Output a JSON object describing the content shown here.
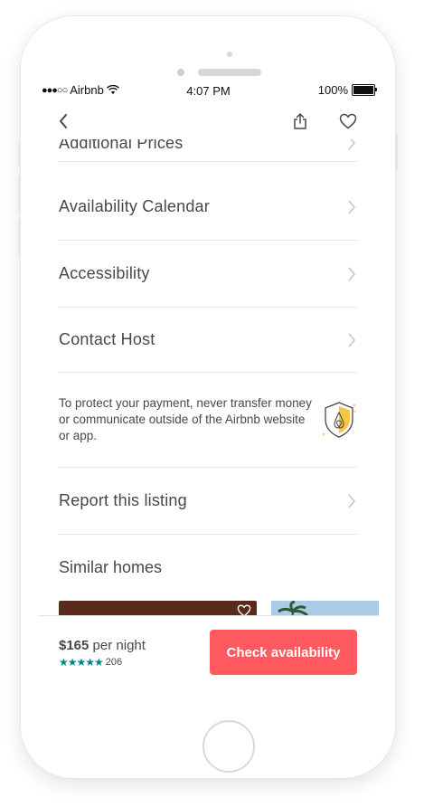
{
  "status_bar": {
    "carrier": "Airbnb",
    "time": "4:07 PM",
    "battery": "100%"
  },
  "navbar": {
    "back_icon": "chevron-left-icon",
    "share_icon": "share-icon",
    "favorite_icon": "heart-icon"
  },
  "menu_items": [
    {
      "label": "Additional Prices"
    },
    {
      "label": "Availability Calendar"
    },
    {
      "label": "Accessibility"
    },
    {
      "label": "Contact Host"
    }
  ],
  "safety": {
    "message": "To protect your payment, never transfer money or communicate outside of the Airbnb website or app.",
    "icon": "shield-icon"
  },
  "report": {
    "label": "Report this listing"
  },
  "similar": {
    "title": "Similar homes"
  },
  "footer": {
    "price": "$165",
    "price_unit": "per night",
    "stars": 5,
    "review_count": "206",
    "cta_label": "Check availability"
  },
  "colors": {
    "brand": "#ff5a5f",
    "stars": "#008489",
    "text": "#484848"
  }
}
